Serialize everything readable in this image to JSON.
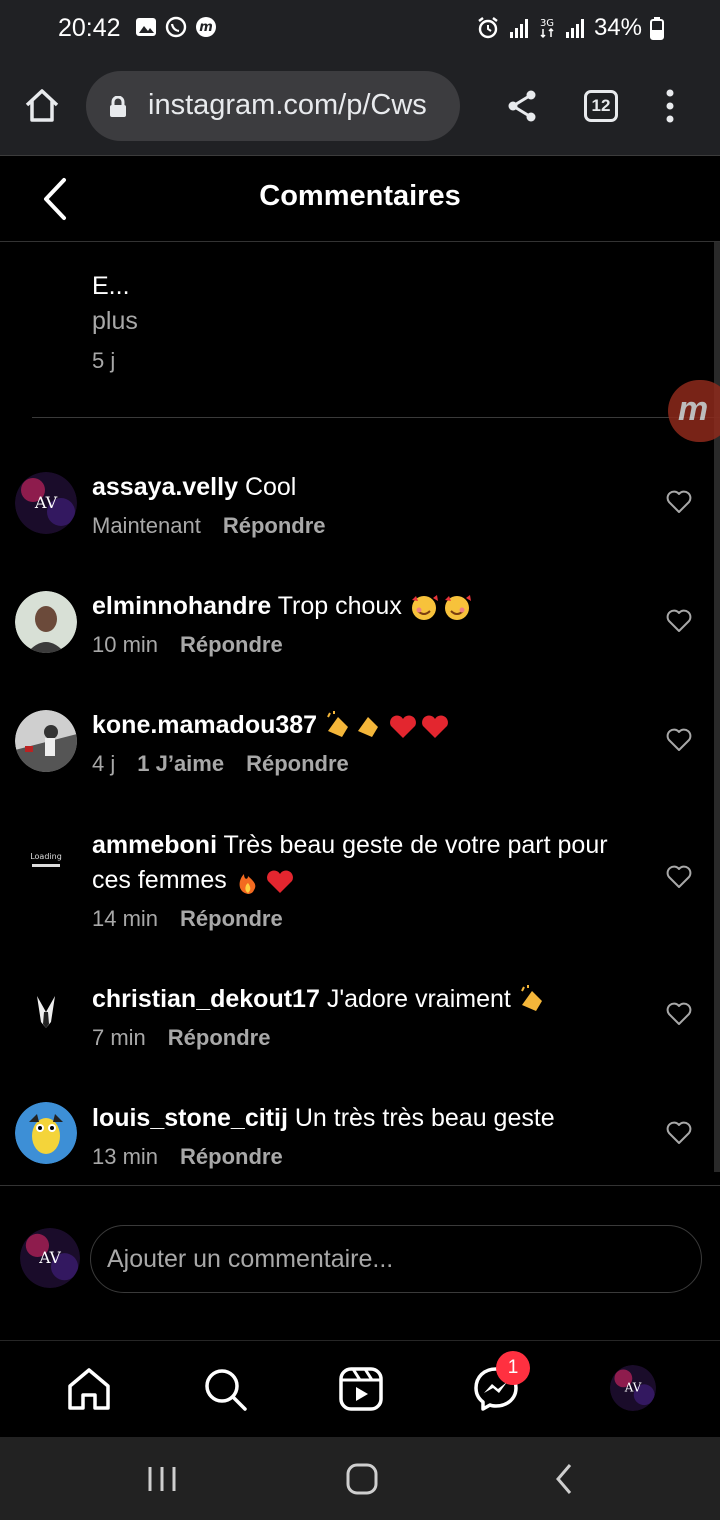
{
  "status_bar": {
    "time": "20:42",
    "battery": "34%"
  },
  "browser": {
    "url": "instagram.com/p/Cws",
    "tab_count": "12"
  },
  "header": {
    "title": "Commentaires"
  },
  "caption": {
    "text": "E...",
    "more": "plus",
    "age": "5 j"
  },
  "overlay_bubble": {
    "label": "m"
  },
  "comments": [
    {
      "username": "assaya.velly",
      "text": "Cool",
      "time": "Maintenant",
      "likes": "",
      "reply": "Répondre"
    },
    {
      "username": "elminnohandre",
      "text": "Trop choux",
      "time": "10 min",
      "likes": "",
      "reply": "Répondre"
    },
    {
      "username": "kone.mamadou387",
      "text": "",
      "time": "4 j",
      "likes": "1 J’aime",
      "reply": "Répondre"
    },
    {
      "username": "ammeboni",
      "text": "Très beau geste de votre part pour ces femmes",
      "time": "14 min",
      "likes": "",
      "reply": "Répondre"
    },
    {
      "username": "christian_dekout17",
      "text": "J'adore vraiment",
      "time": "7 min",
      "likes": "",
      "reply": "Répondre"
    },
    {
      "username": "louis_stone_citij",
      "text": "Un très très beau geste",
      "time": "13 min",
      "likes": "",
      "reply": "Répondre"
    }
  ],
  "avatars": {
    "initials": "AV",
    "loading_text": "Loading"
  },
  "input": {
    "placeholder": "Ajouter un commentaire..."
  },
  "bottom_nav": {
    "messages_badge": "1"
  },
  "colors": {
    "background": "#000000",
    "chrome_bar": "#202124",
    "muted_text": "#a8a8a8",
    "badge": "#ff3040"
  }
}
